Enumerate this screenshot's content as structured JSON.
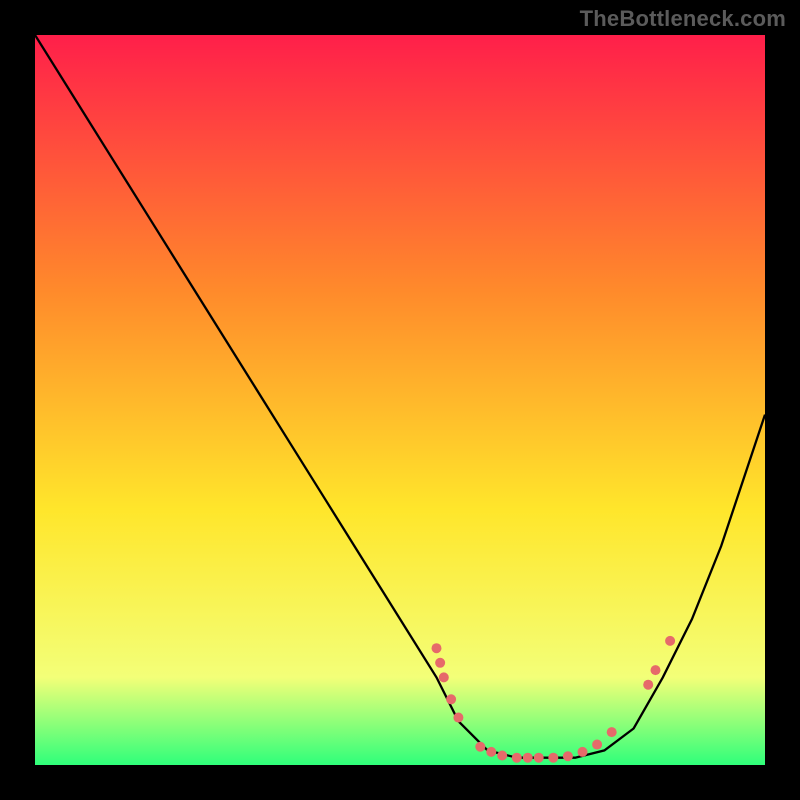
{
  "attribution": "TheBottleneck.com",
  "chart_data": {
    "type": "line",
    "title": "",
    "xlabel": "",
    "ylabel": "",
    "xlim": [
      0,
      100
    ],
    "ylim": [
      0,
      100
    ],
    "grid": false,
    "legend": false,
    "background_gradient": {
      "top": "#ff1f4a",
      "mid_upper": "#ff8a2b",
      "mid": "#ffe62b",
      "lower": "#f3ff78",
      "bottom": "#2fff7a"
    },
    "series": [
      {
        "name": "bottleneck-curve",
        "x": [
          0,
          5,
          10,
          15,
          20,
          25,
          30,
          35,
          40,
          45,
          50,
          55,
          58,
          62,
          66,
          70,
          74,
          78,
          82,
          86,
          90,
          94,
          100
        ],
        "y": [
          100,
          92,
          84,
          76,
          68,
          60,
          52,
          44,
          36,
          28,
          20,
          12,
          6,
          2,
          1,
          1,
          1,
          2,
          5,
          12,
          20,
          30,
          48
        ]
      }
    ],
    "markers": [
      {
        "x": 55.0,
        "y": 16.0
      },
      {
        "x": 55.5,
        "y": 14.0
      },
      {
        "x": 56.0,
        "y": 12.0
      },
      {
        "x": 57.0,
        "y": 9.0
      },
      {
        "x": 58.0,
        "y": 6.5
      },
      {
        "x": 61.0,
        "y": 2.5
      },
      {
        "x": 62.5,
        "y": 1.8
      },
      {
        "x": 64.0,
        "y": 1.3
      },
      {
        "x": 66.0,
        "y": 1.0
      },
      {
        "x": 67.5,
        "y": 1.0
      },
      {
        "x": 69.0,
        "y": 1.0
      },
      {
        "x": 71.0,
        "y": 1.0
      },
      {
        "x": 73.0,
        "y": 1.2
      },
      {
        "x": 75.0,
        "y": 1.8
      },
      {
        "x": 77.0,
        "y": 2.8
      },
      {
        "x": 79.0,
        "y": 4.5
      },
      {
        "x": 84.0,
        "y": 11.0
      },
      {
        "x": 85.0,
        "y": 13.0
      },
      {
        "x": 87.0,
        "y": 17.0
      }
    ],
    "marker_style": {
      "color": "#e66a6a",
      "radius": 5
    }
  }
}
